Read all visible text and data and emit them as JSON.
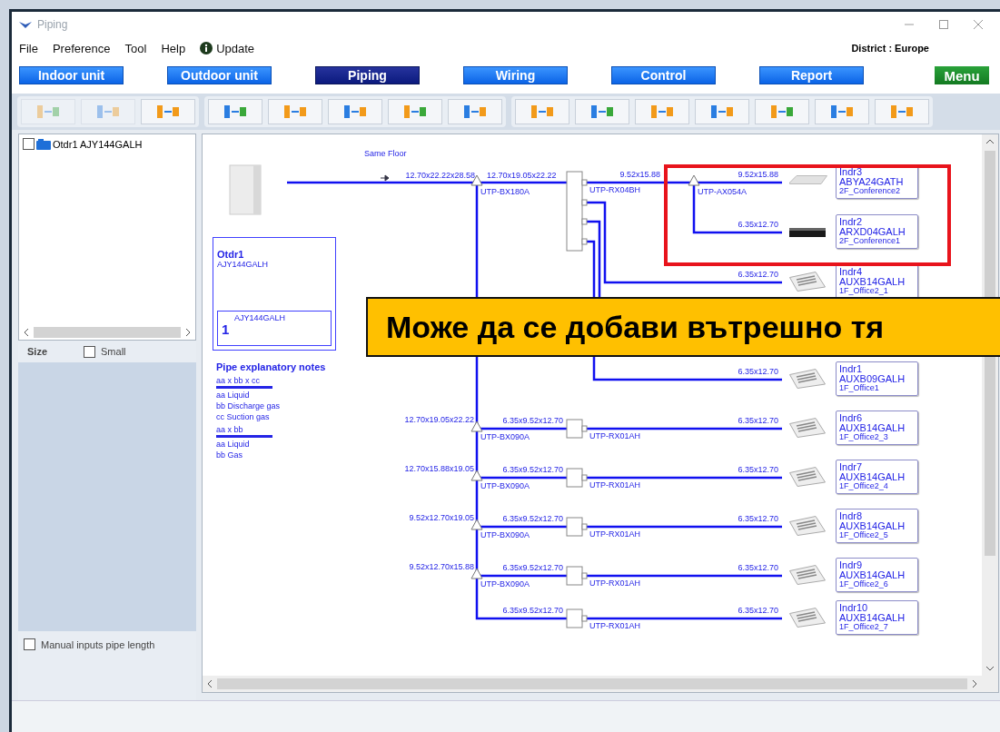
{
  "window": {
    "title": "Piping"
  },
  "menu": [
    {
      "label": "File",
      "kind": "plain"
    },
    {
      "label": "Preference",
      "kind": "plain"
    },
    {
      "label": "Tool",
      "kind": "plain"
    },
    {
      "label": "Help",
      "kind": "plain"
    },
    {
      "label": "Update",
      "kind": "info"
    }
  ],
  "district": "District : Europe",
  "tabs": [
    {
      "label": "Indoor unit",
      "selected": false
    },
    {
      "label": "Outdoor unit",
      "selected": false
    },
    {
      "label": "Piping",
      "selected": true
    },
    {
      "label": "Wiring",
      "selected": false
    },
    {
      "label": "Control",
      "selected": false
    },
    {
      "label": "Report",
      "selected": false
    }
  ],
  "menu_button": "Menu",
  "toolbar": [
    [
      {
        "disabled": true
      },
      {
        "disabled": true
      },
      {
        "disabled": false
      }
    ],
    [
      {
        "disabled": false
      },
      {
        "disabled": false
      },
      {
        "disabled": false
      },
      {
        "disabled": false
      },
      {
        "disabled": false
      }
    ],
    [
      {
        "disabled": false
      },
      {
        "disabled": false
      },
      {
        "disabled": false
      },
      {
        "disabled": false
      },
      {
        "disabled": false
      },
      {
        "disabled": false
      },
      {
        "disabled": false
      }
    ]
  ],
  "tree": {
    "items": [
      {
        "label": "Otdr1 AJY144GALH",
        "checked": false
      }
    ]
  },
  "size": {
    "label": "Size",
    "option": {
      "label": "Small",
      "checked": false
    }
  },
  "manual_input": {
    "label": "Manual inputs pipe length",
    "checked": false
  },
  "diagram": {
    "floor": "Same Floor",
    "outdoor": {
      "name": "Otdr1",
      "model": "AJY144GALH",
      "unit_model": "AJY144GALH",
      "count": "1"
    },
    "notes": {
      "title": "Pipe explanatory notes",
      "groups": [
        {
          "formula": "aa x bb x cc",
          "lines": [
            "aa Liquid",
            "bb Discharge gas",
            "cc Suction gas"
          ]
        },
        {
          "formula": "aa x bb",
          "lines": [
            "aa Liquid",
            "bb Gas"
          ]
        }
      ]
    },
    "main_pipes": [
      "12.70x22.22x28.58",
      "12.70x19.05x22.22"
    ],
    "main_joint": "UTP-BX180A",
    "header": "UTP-RX04BH",
    "sub_pipe": "9.52x15.88",
    "sub_joint": "UTP-AX054A",
    "branches": [
      {
        "main_pipe": "12.70x19.05x22.22",
        "branch_pipe": "6.35x9.52x12.70",
        "joint": "UTP-BX090A",
        "header": "UTP-RX01AH"
      },
      {
        "main_pipe": "12.70x15.88x19.05",
        "branch_pipe": "6.35x9.52x12.70",
        "joint": "UTP-BX090A",
        "header": "UTP-RX01AH"
      },
      {
        "main_pipe": "9.52x12.70x19.05",
        "branch_pipe": "6.35x9.52x12.70",
        "joint": "UTP-BX090A",
        "header": "UTP-RX01AH"
      },
      {
        "main_pipe": "9.52x12.70x15.88",
        "branch_pipe": "6.35x9.52x12.70",
        "joint": "UTP-BX090A",
        "header": "UTP-RX01AH"
      },
      {
        "branch_pipe": "6.35x9.52x12.70",
        "header": "UTP-RX01AH"
      }
    ],
    "indoor_units": [
      {
        "name": "Indr3",
        "model": "ABYA24GATH",
        "room": "2F_Conference2",
        "pipe": "9.52x15.88",
        "kind": "ceiling"
      },
      {
        "name": "Indr2",
        "model": "ARXD04GALH",
        "room": "2F_Conference1",
        "pipe": "6.35x12.70",
        "kind": "duct"
      },
      {
        "name": "Indr4",
        "model": "AUXB14GALH",
        "room": "1F_Office2_1",
        "pipe": "6.35x12.70",
        "kind": "cassette"
      },
      {
        "name": "Indr1",
        "model": "AUXB09GALH",
        "room": "1F_Office1",
        "pipe": "6.35x12.70",
        "kind": "cassette"
      },
      {
        "name": "Indr6",
        "model": "AUXB14GALH",
        "room": "1F_Office2_3",
        "pipe": "6.35x12.70",
        "kind": "cassette"
      },
      {
        "name": "Indr7",
        "model": "AUXB14GALH",
        "room": "1F_Office2_4",
        "pipe": "6.35x12.70",
        "kind": "cassette"
      },
      {
        "name": "Indr8",
        "model": "AUXB14GALH",
        "room": "1F_Office2_5",
        "pipe": "6.35x12.70",
        "kind": "cassette"
      },
      {
        "name": "Indr9",
        "model": "AUXB14GALH",
        "room": "1F_Office2_6",
        "pipe": "6.35x12.70",
        "kind": "cassette"
      },
      {
        "name": "Indr10",
        "model": "AUXB14GALH",
        "room": "1F_Office2_7",
        "pipe": "6.35x12.70",
        "kind": "cassette"
      }
    ]
  },
  "overlay": {
    "text": "Може да се добави вътрешно тя"
  }
}
